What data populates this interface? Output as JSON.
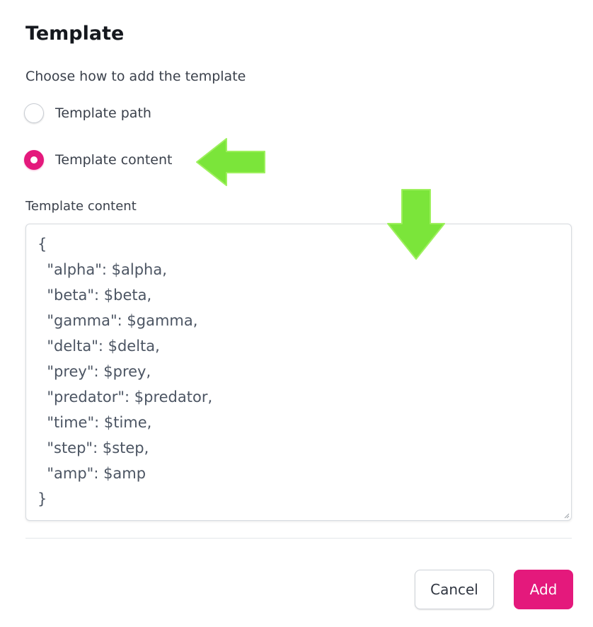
{
  "dialog": {
    "title": "Template",
    "subtitle": "Choose how to add the template"
  },
  "radio_options": [
    {
      "label": "Template path",
      "checked": false
    },
    {
      "label": "Template content",
      "checked": true
    }
  ],
  "template_content": {
    "label": "Template content",
    "lines": [
      "{",
      "  \"alpha\": $alpha,",
      "  \"beta\": $beta,",
      "  \"gamma\": $gamma,",
      "  \"delta\": $delta,",
      "  \"prey\": $prey,",
      "  \"predator\": $predator,",
      "  \"time\": $time,",
      "  \"step\": $step,",
      "  \"amp\": $amp",
      "}"
    ]
  },
  "buttons": {
    "cancel": "Cancel",
    "add": "Add"
  },
  "colors": {
    "accent": "#e4197c",
    "annotation_arrow": "#7be53a"
  },
  "annotations": [
    {
      "icon": "green-arrow-left-icon"
    },
    {
      "icon": "green-arrow-down-icon"
    }
  ]
}
